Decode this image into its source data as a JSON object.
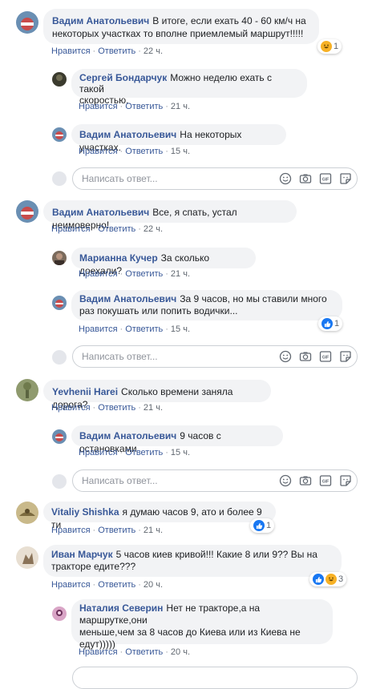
{
  "like_label": "Нравится",
  "reply_label": "Ответить",
  "reply_placeholder": "Написать ответ...",
  "comments": [
    {
      "author": "Вадим Анатольевич",
      "text_line1": "В итоге, если ехать 40 - 60 км/ч на",
      "text_line2": "некоторых участках то вполне приемлемый маршрут!!!!!",
      "time": "22 ч.",
      "reaction_count": "1"
    },
    {
      "author": "Сергей Бондарчук",
      "text_line1": "Можно неделю ехать с такой",
      "text_line2": "скоростью.",
      "time": "21 ч."
    },
    {
      "author": "Вадим Анатольевич",
      "text": "На некоторых участках.",
      "time": "15 ч."
    },
    {
      "author": "Вадим Анатольевич",
      "text": "Все, я спать, устал неимоверно!",
      "time": "22 ч."
    },
    {
      "author": "Марианна Кучер",
      "text": "За сколько доехали?",
      "time": "21 ч."
    },
    {
      "author": "Вадим Анатольевич",
      "text_line1": "За 9 часов, но мы ставили много",
      "text_line2": "раз покушать или попить водички...",
      "time": "15 ч.",
      "reaction_count": "1"
    },
    {
      "author": "Yevhenii Harei",
      "text": "Сколько времени заняла дорога?",
      "time": "21 ч."
    },
    {
      "author": "Вадим Анатольевич",
      "text": "9 часов с остановками",
      "time": "15 ч."
    },
    {
      "author": "Vitaliy Shishka",
      "text": "я думаю часов 9, ато и более 9 ти",
      "time": "21 ч.",
      "reaction_count": "1"
    },
    {
      "author": "Иван Марчук",
      "text_line1": "5 часов киев кривой!!! Какие 8 или 9?? Вы на",
      "text_line2": "тракторе едите???",
      "time": "20 ч.",
      "reaction_count": "3"
    },
    {
      "author": "Наталия Северин",
      "text_line1": "Нет не тракторе,а на маршрутке,они",
      "text_line2": "меньше,чем за 8 часов до Киева или из Киева не",
      "text_line3": "едут)))))",
      "time": "20 ч."
    }
  ],
  "colors": {
    "link": "#385898",
    "bubble": "#f2f3f5",
    "meta": "#606770",
    "like_blue": "#1877f2",
    "haha_yellow": "#f7b125"
  }
}
